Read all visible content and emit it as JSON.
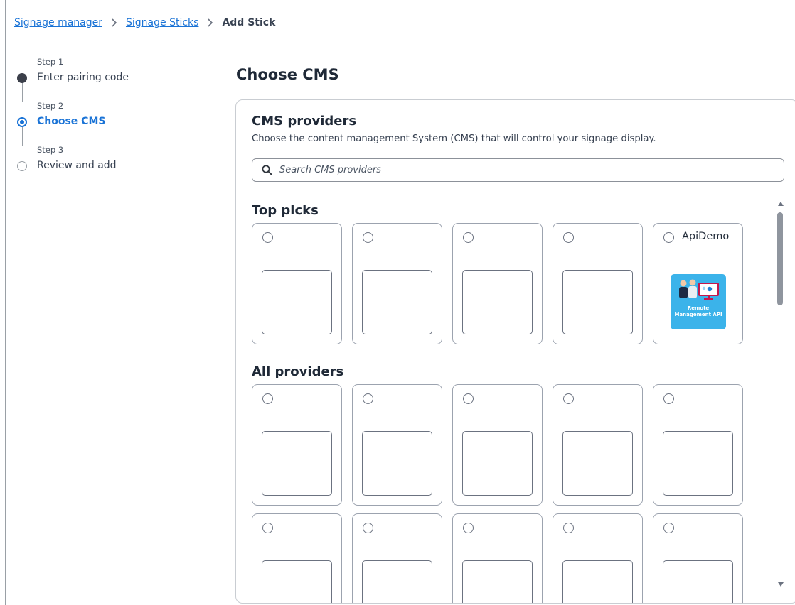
{
  "breadcrumb": {
    "items": [
      {
        "label": "Signage manager"
      },
      {
        "label": "Signage Sticks"
      }
    ],
    "current": "Add Stick"
  },
  "steps": [
    {
      "number": "Step 1",
      "label": "Enter pairing code",
      "state": "done"
    },
    {
      "number": "Step 2",
      "label": "Choose CMS",
      "state": "active"
    },
    {
      "number": "Step 3",
      "label": "Review and add",
      "state": "pending"
    }
  ],
  "main": {
    "title": "Choose CMS",
    "panel": {
      "title": "CMS providers",
      "description": "Choose the content management System (CMS) that will control your signage display.",
      "search": {
        "placeholder": "Search CMS providers",
        "value": "",
        "icon": "search-icon"
      }
    },
    "top_picks": {
      "title": "Top picks",
      "cards": [
        {
          "name": "",
          "logo": "empty"
        },
        {
          "name": "",
          "logo": "empty"
        },
        {
          "name": "",
          "logo": "empty"
        },
        {
          "name": "",
          "logo": "empty"
        },
        {
          "name": "ApiDemo",
          "logo": "remote-management-api-logo",
          "logo_text": "Remote Management API"
        }
      ]
    },
    "all_providers": {
      "title": "All providers",
      "rows": [
        [
          {
            "name": ""
          },
          {
            "name": ""
          },
          {
            "name": ""
          },
          {
            "name": ""
          },
          {
            "name": ""
          }
        ],
        [
          {
            "name": ""
          },
          {
            "name": ""
          },
          {
            "name": ""
          },
          {
            "name": ""
          },
          {
            "name": ""
          }
        ]
      ]
    }
  },
  "colors": {
    "accent": "#1a73d6",
    "text": "#1f2937",
    "border": "#9ca3af",
    "logo_tile": "#3bb3ea"
  }
}
